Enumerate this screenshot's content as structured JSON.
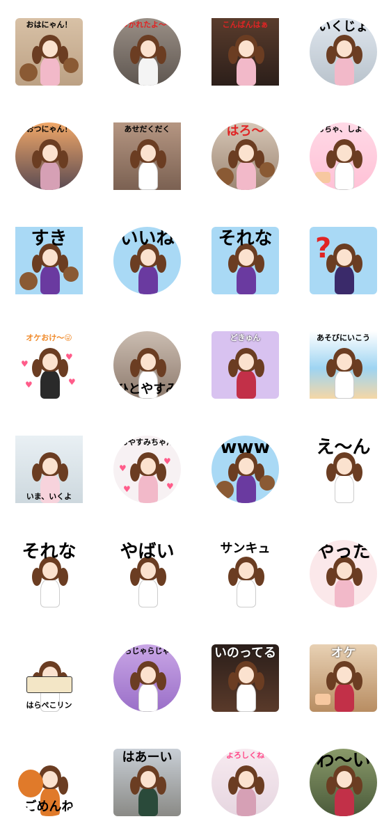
{
  "stickers": [
    {
      "label": "おはにゃん！",
      "pos": "top",
      "size": "small",
      "color": "#000000",
      "shape": "square",
      "bg": "linear-gradient(#d8c1a6,#bca184)",
      "hair": "#6b3d22",
      "outfit": "#f2b9c9",
      "extra": "bears"
    },
    {
      "label": "つかれたよ〜〜",
      "pos": "top",
      "size": "small",
      "color": "#e02424",
      "shape": "round",
      "bg": "linear-gradient(#9a8f86,#5e5650)",
      "hair": "#6b3d22",
      "outfit": "#f4f4f4",
      "extra": ""
    },
    {
      "label": "こんばんはぁ",
      "pos": "top",
      "size": "small",
      "color": "#e02424",
      "shape": "plain",
      "bg": "linear-gradient(#5a3c2c,#2c1f1a)",
      "hair": "#6b3d22",
      "outfit": "#f2b9c9",
      "extra": ""
    },
    {
      "label": "いくじょ",
      "pos": "top",
      "size": "mid",
      "color": "#000000",
      "shape": "round",
      "bg": "linear-gradient(#dfe6ee,#b9c3cc)",
      "hair": "#6b3d22",
      "outfit": "#f2b9c9",
      "extra": ""
    },
    {
      "label": "おつにゃん！",
      "pos": "top",
      "size": "small",
      "color": "#000000",
      "shape": "round",
      "bg": "linear-gradient(#f0a768,#5a4a52)",
      "hair": "#6b3d22",
      "outfit": "#d6a0b5",
      "extra": ""
    },
    {
      "label": "あせだくだく",
      "pos": "top",
      "size": "small",
      "color": "#000000",
      "shape": "plain",
      "bg": "linear-gradient(#b59682,#7b6152)",
      "hair": "#6b3d22",
      "outfit": "#ffffff",
      "extra": ""
    },
    {
      "label": "はろ〜",
      "pos": "top",
      "size": "mid",
      "color": "#e02424",
      "shape": "round",
      "bg": "linear-gradient(#d6c6b6,#9c8673)",
      "hair": "#6b3d22",
      "outfit": "#f2b9c9",
      "extra": "bears"
    },
    {
      "label": "おちゃ、しよー",
      "pos": "top",
      "size": "small",
      "color": "#000000",
      "shape": "round",
      "bg": "linear-gradient(#ffd9e6,#ffc1d6)",
      "hair": "#6b3d22",
      "outfit": "#ffffff",
      "extra": "cake"
    },
    {
      "label": "すき",
      "pos": "top",
      "size": "big",
      "color": "#000000",
      "shape": "plain",
      "bg": "#a9d9f5",
      "hair": "#6b3d22",
      "outfit": "#6a3aa0",
      "extra": "bears"
    },
    {
      "label": "いいね",
      "pos": "top",
      "size": "big",
      "color": "#000000",
      "shape": "round",
      "bg": "#a9d9f5",
      "hair": "#6b3d22",
      "outfit": "#6a3aa0",
      "extra": ""
    },
    {
      "label": "それな",
      "pos": "top",
      "size": "big",
      "color": "#000000",
      "shape": "square",
      "bg": "#a9d9f5",
      "hair": "#6b3d22",
      "outfit": "#6a3aa0",
      "extra": ""
    },
    {
      "label": "",
      "pos": "top",
      "size": "big",
      "color": "#000000",
      "shape": "square",
      "bg": "#a9d9f5",
      "hair": "#6b3d22",
      "outfit": "#3a2a6a",
      "extra": "question"
    },
    {
      "label": "オケおけ〜😜",
      "pos": "top",
      "size": "small",
      "color": "#f08a2a",
      "shape": "plain",
      "bg": "#ffffff",
      "hair": "#6b3d22",
      "outfit": "#2a2a2a",
      "extra": "hearts"
    },
    {
      "label": "ひとやすみ",
      "pos": "bottom",
      "size": "mid",
      "color": "#000000",
      "shape": "round",
      "bg": "linear-gradient(#cbbdb1,#8e7b6e)",
      "hair": "#6b3d22",
      "outfit": "#ffffff",
      "extra": ""
    },
    {
      "label": "どきゅん",
      "pos": "top",
      "size": "small",
      "color": "#ffffff",
      "shape": "square",
      "bg": "#d8c2f0",
      "hair": "#6b3d22",
      "outfit": "#c23048",
      "extra": ""
    },
    {
      "label": "あそびにいこう",
      "pos": "top",
      "size": "small",
      "color": "#000000",
      "shape": "plain",
      "bg": "linear-gradient(#ffffff,#9ed4f2 55%,#f5d7a6)",
      "hair": "#6b3d22",
      "outfit": "#ffffff",
      "extra": ""
    },
    {
      "label": "いま、いくよ",
      "pos": "bottom",
      "size": "small",
      "color": "#000000",
      "shape": "plain",
      "bg": "linear-gradient(#e9f0f4,#cdd8de)",
      "hair": "#6b3d22",
      "outfit": "#f7d3dc",
      "extra": ""
    },
    {
      "label": "おやすみちゃん",
      "pos": "top",
      "size": "small",
      "color": "#000000",
      "shape": "round",
      "bg": "#f7f1f3",
      "hair": "#6b3d22",
      "outfit": "#f2b9c9",
      "extra": "hearts"
    },
    {
      "label": "www",
      "pos": "top",
      "size": "big",
      "color": "#000000",
      "shape": "round",
      "bg": "#a9d9f5",
      "hair": "#6b3d22",
      "outfit": "#6a3aa0",
      "extra": "bears"
    },
    {
      "label": "え〜ん",
      "pos": "top",
      "size": "big",
      "color": "#000000",
      "shape": "plain",
      "bg": "#ffffff",
      "hair": "#6b3d22",
      "outfit": "#ffffff",
      "extra": ""
    },
    {
      "label": "それな",
      "pos": "top",
      "size": "big",
      "color": "#000000",
      "shape": "plain",
      "bg": "#ffffff",
      "hair": "#6b3d22",
      "outfit": "#ffffff",
      "extra": ""
    },
    {
      "label": "やばい",
      "pos": "top",
      "size": "big",
      "color": "#000000",
      "shape": "plain",
      "bg": "#ffffff",
      "hair": "#6b3d22",
      "outfit": "#ffffff",
      "extra": ""
    },
    {
      "label": "サンキュ",
      "pos": "top",
      "size": "mid",
      "color": "#000000",
      "shape": "plain",
      "bg": "#ffffff",
      "hair": "#6b3d22",
      "outfit": "#ffffff",
      "extra": ""
    },
    {
      "label": "やった",
      "pos": "top",
      "size": "big",
      "color": "#000000",
      "shape": "round",
      "bg": "#fbe8ea",
      "hair": "#6b3d22",
      "outfit": "#f2b9c9",
      "extra": ""
    },
    {
      "label": "はらぺこリン",
      "pos": "bottom",
      "size": "small",
      "color": "#000000",
      "shape": "plain",
      "bg": "#ffffff",
      "hair": "#6b3d22",
      "outfit": "#ffffff",
      "extra": "rice"
    },
    {
      "label": "らじゃらじゃ",
      "pos": "top",
      "size": "small",
      "color": "#000000",
      "shape": "round",
      "bg": "linear-gradient(#c9a6e6,#9a6fc8)",
      "hair": "#6b3d22",
      "outfit": "#ffffff",
      "extra": ""
    },
    {
      "label": "いのってる",
      "pos": "top",
      "size": "mid",
      "color": "#ffffff",
      "shape": "square",
      "bg": "linear-gradient(#2a1e1a,#5a3a2a)",
      "hair": "#6b3d22",
      "outfit": "#ffffff",
      "extra": ""
    },
    {
      "label": "オケ",
      "pos": "top",
      "size": "mid",
      "color": "#ffffff",
      "shape": "square",
      "bg": "linear-gradient(#e8d1b4,#b88d62)",
      "hair": "#6b3d22",
      "outfit": "#c23048",
      "extra": "cake"
    },
    {
      "label": "ごめんね",
      "pos": "bottom",
      "size": "mid",
      "color": "#000000",
      "shape": "round",
      "bg": "#ffffff",
      "hair": "#6b3d22",
      "outfit": "#e07a2a",
      "extra": "teddy"
    },
    {
      "label": "はあーい",
      "pos": "top",
      "size": "mid",
      "color": "#000000",
      "shape": "square",
      "bg": "linear-gradient(#c9cfd6,#8a8a86)",
      "hair": "#6b3d22",
      "outfit": "#2a4a3a",
      "extra": ""
    },
    {
      "label": "よろしくね",
      "pos": "top",
      "size": "small",
      "color": "#ff4a8a",
      "shape": "round",
      "bg": "linear-gradient(#f7eaf0,#e6d6e0)",
      "hair": "#6b3d22",
      "outfit": "#d6a0b5",
      "extra": ""
    },
    {
      "label": "わ〜い",
      "pos": "top",
      "size": "big",
      "color": "#000000",
      "shape": "round",
      "bg": "linear-gradient(#8a9a6a,#4a5a3a)",
      "hair": "#6b3d22",
      "outfit": "#c23048",
      "extra": ""
    }
  ]
}
